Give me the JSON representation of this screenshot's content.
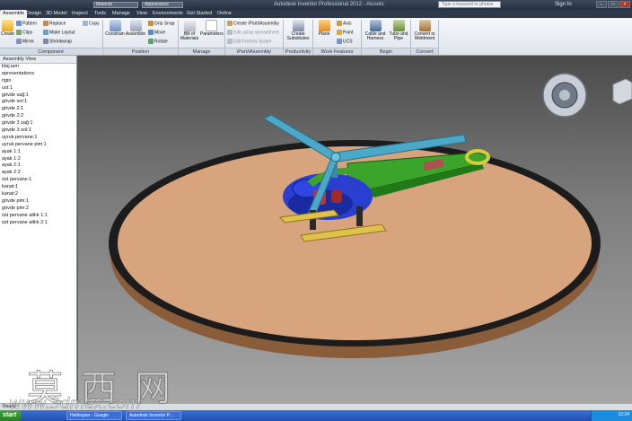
{
  "titlebar": {
    "qa_field1": "Material",
    "qa_field2": "Appearance",
    "app_title": "Autodesk Inventor Professional 2012 - Alcoots",
    "help_placeholder": "Type a keyword or phrase",
    "signin": "Sign In"
  },
  "tabs": [
    "Assemble",
    "Design",
    "3D Model",
    "Inspect",
    "Tools",
    "Manage",
    "View",
    "Environments",
    "Get Started",
    "Online"
  ],
  "ribbon": {
    "component": {
      "create": "Create",
      "place_items": [
        "Pattern",
        "Replace",
        "Copy"
      ],
      "place2": [
        "Clips",
        "Make Layout",
        "Mirror",
        "Shrinkwrap"
      ],
      "label": "Component"
    },
    "position": {
      "constrain": "Constrain",
      "assemble": "Assemble",
      "items": [
        "Grip Snap",
        "Move",
        "Rotate"
      ],
      "label": "Position"
    },
    "manage": {
      "bom": "Bill of Materials",
      "params": "Parameters",
      "label": "Manage"
    },
    "partassembly": {
      "items": [
        "Create iPart/iAssembly",
        "Edit using spreadsheet",
        "Edit Factory Scope"
      ],
      "label": "iPart/iAssembly"
    },
    "productivity": {
      "subst": "Create Substitutes",
      "label": "Productivity"
    },
    "work": {
      "plane": "Plane",
      "items": [
        "Axis",
        "Point",
        "UCS"
      ],
      "label": "Work Features"
    },
    "begin": {
      "cable": "Cable and Harness",
      "tube": "Tube and Pipe",
      "label": "Begin"
    },
    "convert": {
      "c": "Convert to Weldment",
      "label": "Convert"
    }
  },
  "browser": {
    "header": "Assembly View",
    "items": [
      "ktaj.iam",
      "epresentations",
      "rigin",
      "ust:1",
      "gövde sağ:1",
      "gövde sol:1",
      "gövde 2:1",
      "gövde 2:2",
      "gövde 3 sağ:1",
      "gövde 3 sol:1",
      "uyruk pervane:1",
      "uyruk pervane pim:1",
      "ayak 1:1",
      "ayak 1:2",
      "ayak 2:1",
      "ayak 2:2",
      "üst pervane:1",
      "kanat:1",
      "kanat:2",
      "gövde pim:1",
      "gövde pim:2",
      "üst pervane altlık 1:1",
      "üst pervane altlık 2:1"
    ]
  },
  "status": "Ready",
  "taskbar": {
    "start": "start",
    "tasks": [
      "Helikopter - Google",
      "Autodesk Inventor P..."
    ],
    "clock": "12:34"
  },
  "watermark": {
    "cn": "莫西网",
    "url": "www.3dmax.com"
  },
  "colors": {
    "body_blue": "#2a3fd0",
    "frame_green": "#3aa52a",
    "blade_cyan": "#4aa8c8",
    "rotor_yellow": "#d8cc3a",
    "disk_tan": "#d8a47e",
    "disk_rim": "#202020"
  }
}
